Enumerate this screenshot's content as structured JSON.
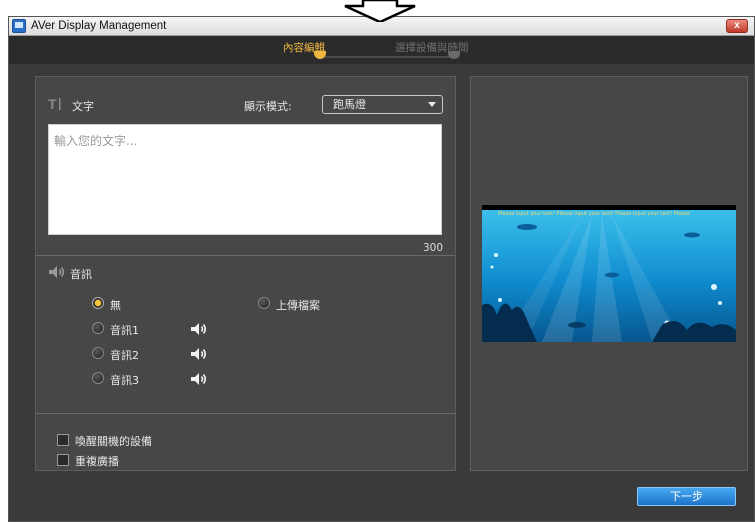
{
  "window": {
    "title": "AVer Display Management",
    "close_label": "x"
  },
  "steps": [
    {
      "label": "內容編輯",
      "active": true
    },
    {
      "label": "選擇設備與時間",
      "active": false
    }
  ],
  "text_section": {
    "title": "文字",
    "mode_label": "顯示模式:",
    "mode_value": "跑馬燈",
    "placeholder": "輸入您的文字...",
    "char_counter": "300"
  },
  "audio_section": {
    "title": "音訊",
    "options": [
      {
        "label": "無",
        "selected": true,
        "has_preview": false
      },
      {
        "label": "上傳檔案",
        "selected": false,
        "has_preview": false
      },
      {
        "label": "音訊1",
        "selected": false,
        "has_preview": true
      },
      {
        "label": "音訊2",
        "selected": false,
        "has_preview": true
      },
      {
        "label": "音訊3",
        "selected": false,
        "has_preview": true
      }
    ]
  },
  "options": {
    "wake_devices": {
      "label": "喚醒關機的設備",
      "checked": false
    },
    "repeat": {
      "label": "重複廣播",
      "checked": false
    }
  },
  "preview": {
    "marquee_text": "Please input your text!   Please input your text!   Please input your text!   Please"
  },
  "footer": {
    "next_label": "下一步"
  },
  "colors": {
    "accent": "#f0b740",
    "background": "#3a3a3a",
    "panel": "#474747",
    "button": "#2a8de0"
  }
}
